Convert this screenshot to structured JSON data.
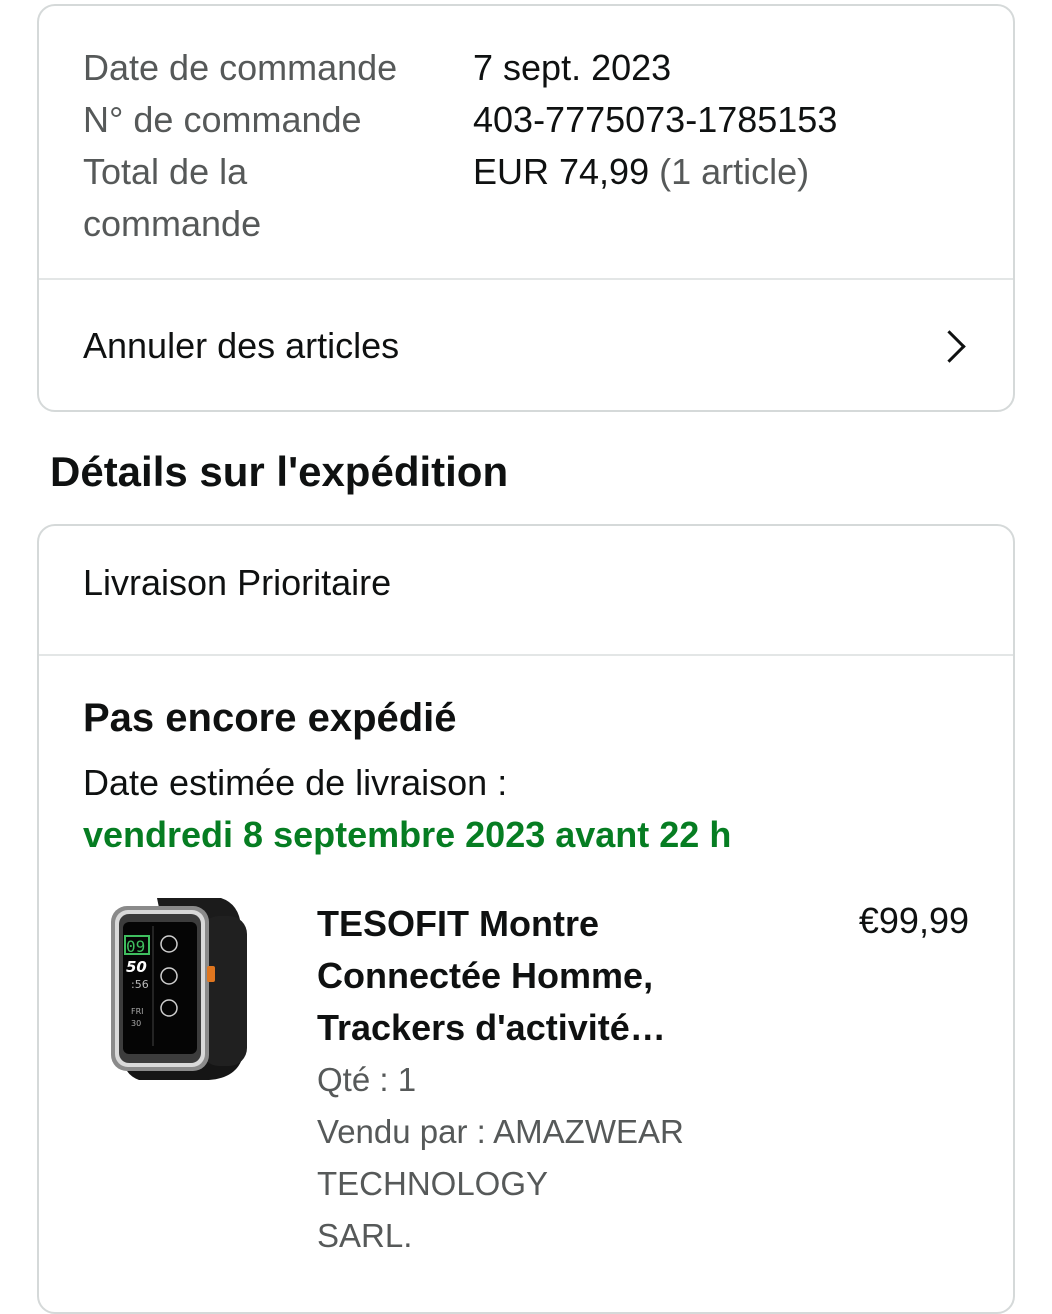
{
  "order": {
    "date_label": "Date de commande",
    "date_value": "7 sept. 2023",
    "number_label": "N° de commande",
    "number_value": "403-7775073-1785153",
    "total_label_line1": "Total de la",
    "total_label_line2": "commande",
    "total_value": "EUR 74,99",
    "total_count": "(1 article)",
    "cancel_label": "Annuler des articles"
  },
  "shipping": {
    "section_title": "Détails sur l'expédition",
    "method": "Livraison Prioritaire",
    "status": "Pas encore expédié",
    "estimate_label": "Date estimée de livraison :",
    "estimate_date": "vendredi 8 septembre 2023 avant 22 h",
    "estimate_color": "#067d22"
  },
  "product": {
    "title_line1": "TESOFIT Montre",
    "title_line2": "Connectée Homme,",
    "title_line3": "Trackers d'activité…",
    "price": "€99,99",
    "quantity": "Qté : 1",
    "seller_line1": "Vendu par : AMAZWEAR TECHNOLOGY",
    "seller_line2": "SARL.",
    "image_icon": "smartwatch-image",
    "watch_display": {
      "hour": "09",
      "minute": "50",
      "seconds": ":56",
      "day": "FRI",
      "date": "30"
    }
  }
}
